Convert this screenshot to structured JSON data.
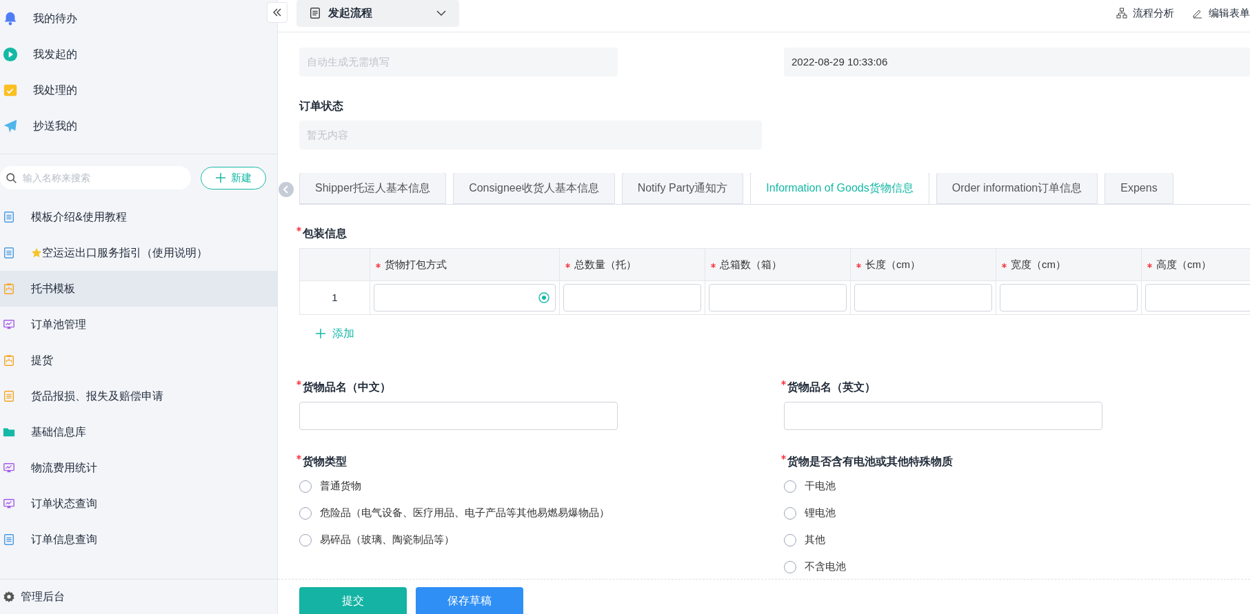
{
  "sidebar": {
    "top_items": [
      {
        "label": "我的待办",
        "kind": "bell"
      },
      {
        "label": "我发起的",
        "kind": "play"
      },
      {
        "label": "我处理的",
        "kind": "tray"
      },
      {
        "label": "抄送我的",
        "kind": "plane"
      }
    ],
    "search": {
      "placeholder": "输入名称来搜索"
    },
    "new_button": "新建",
    "items": [
      {
        "label": "模板介绍&使用教程",
        "kind": "doc",
        "color": "#4a9be0",
        "starred": false,
        "selected": false
      },
      {
        "label": "空运运出口服务指引（使用说明）",
        "kind": "doc",
        "color": "#4a9be0",
        "starred": true,
        "selected": false
      },
      {
        "label": "托书模板",
        "kind": "clipboard",
        "color": "#f5a623",
        "starred": false,
        "selected": true
      },
      {
        "label": "订单池管理",
        "kind": "monitor",
        "color": "#a55ce8",
        "starred": false,
        "selected": false
      },
      {
        "label": "提货",
        "kind": "clipboard",
        "color": "#f5a623",
        "starred": false,
        "selected": false
      },
      {
        "label": "货品报损、报失及赔偿申请",
        "kind": "doc",
        "color": "#f5a623",
        "starred": false,
        "selected": false
      },
      {
        "label": "基础信息库",
        "kind": "folder",
        "color": "#14b8a6",
        "starred": false,
        "selected": false
      },
      {
        "label": "物流费用统计",
        "kind": "monitor",
        "color": "#a55ce8",
        "starred": false,
        "selected": false
      },
      {
        "label": "订单状态查询",
        "kind": "monitor",
        "color": "#a55ce8",
        "starred": false,
        "selected": false
      },
      {
        "label": "订单信息查询",
        "kind": "doc",
        "color": "#4a9be0",
        "starred": false,
        "selected": false
      }
    ],
    "admin": "管理后台"
  },
  "header": {
    "process_menu": "发起流程",
    "actions": [
      {
        "label": "流程分析",
        "kind": "flow"
      },
      {
        "label": "编辑表单",
        "kind": "edit"
      }
    ]
  },
  "form": {
    "order_no": {
      "placeholder": "自动生成无需填写"
    },
    "created_at": {
      "value": "2022-08-29 10:33:06"
    },
    "order_status": {
      "label": "订单状态",
      "placeholder": "暂无内容"
    },
    "tabs": [
      {
        "label": "Shipper托运人基本信息",
        "selected": false
      },
      {
        "label": "Consignee收货人基本信息",
        "selected": false
      },
      {
        "label": "Notify Party通知方",
        "selected": false
      },
      {
        "label": "Information of Goods货物信息",
        "selected": true
      },
      {
        "label": "Order information订单信息",
        "selected": false
      },
      {
        "label": "Expens",
        "selected": false
      }
    ],
    "packaging": {
      "label": "包装信息",
      "required": true,
      "columns": [
        {
          "label": "货物打包方式",
          "required": true
        },
        {
          "label": "总数量（托）",
          "required": true
        },
        {
          "label": "总箱数（箱）",
          "required": true
        },
        {
          "label": "长度（cm）",
          "required": true
        },
        {
          "label": "宽度（cm）",
          "required": true
        },
        {
          "label": "高度（cm）",
          "required": true
        }
      ],
      "rows": [
        {
          "index": "1"
        }
      ],
      "add": "添加"
    },
    "name_cn": {
      "label": "货物品名（中文）",
      "required": true
    },
    "name_en": {
      "label": "货物品名（英文）",
      "required": true
    },
    "goods_type": {
      "label": "货物类型",
      "required": true,
      "options": [
        {
          "label": "普通货物",
          "selected": false
        },
        {
          "label": "危险品（电气设备、医疗用品、电子产品等其他易燃易爆物品）",
          "selected": false
        },
        {
          "label": "易碎品（玻璃、陶瓷制品等）",
          "selected": false
        }
      ]
    },
    "battery": {
      "label": "货物是否含有电池或其他特殊物质",
      "required": true,
      "options": [
        {
          "label": "干电池",
          "selected": false
        },
        {
          "label": "锂电池",
          "selected": false
        },
        {
          "label": "其他",
          "selected": false
        },
        {
          "label": "不含电池",
          "selected": false
        }
      ]
    }
  },
  "footer": {
    "submit": "提交",
    "save_draft": "保存草稿"
  }
}
